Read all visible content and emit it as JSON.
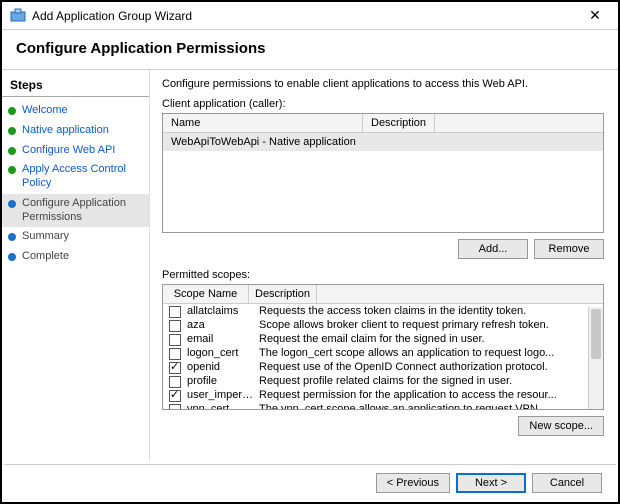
{
  "window": {
    "title": "Add Application Group Wizard"
  },
  "header": "Configure Application Permissions",
  "sidebar": {
    "title": "Steps",
    "items": [
      {
        "label": "Welcome",
        "state": "done",
        "link": true
      },
      {
        "label": "Native application",
        "state": "done",
        "link": true
      },
      {
        "label": "Configure Web API",
        "state": "done",
        "link": true
      },
      {
        "label": "Apply Access Control Policy",
        "state": "done",
        "link": true
      },
      {
        "label": "Configure Application Permissions",
        "state": "current",
        "link": false
      },
      {
        "label": "Summary",
        "state": "pending",
        "link": false
      },
      {
        "label": "Complete",
        "state": "pending",
        "link": false
      }
    ]
  },
  "main": {
    "instruction": "Configure permissions to enable client applications to access this Web API.",
    "clientLabel": "Client application (caller):",
    "clientCols": {
      "name": "Name",
      "desc": "Description"
    },
    "clientRows": [
      {
        "name": "WebApiToWebApi - Native application",
        "desc": ""
      }
    ],
    "addBtn": "Add...",
    "removeBtn": "Remove",
    "permLabel": "Permitted scopes:",
    "scopeCols": {
      "name": "Scope Name",
      "desc": "Description"
    },
    "scopes": [
      {
        "checked": false,
        "name": "allatclaims",
        "desc": "Requests the access token claims in the identity token."
      },
      {
        "checked": false,
        "name": "aza",
        "desc": "Scope allows broker client to request primary refresh token."
      },
      {
        "checked": false,
        "name": "email",
        "desc": "Request the email claim for the signed in user."
      },
      {
        "checked": false,
        "name": "logon_cert",
        "desc": "The logon_cert scope allows an application to request logo..."
      },
      {
        "checked": true,
        "name": "openid",
        "desc": "Request use of the OpenID Connect authorization protocol."
      },
      {
        "checked": false,
        "name": "profile",
        "desc": "Request profile related claims for the signed in user."
      },
      {
        "checked": true,
        "name": "user_imperso...",
        "desc": "Request permission for the application to access the resour..."
      },
      {
        "checked": false,
        "name": "vpn_cert",
        "desc": "The vpn_cert scope allows an application to request VPN ..."
      }
    ],
    "newScopeBtn": "New scope..."
  },
  "footer": {
    "prev": "< Previous",
    "next": "Next >",
    "cancel": "Cancel"
  }
}
